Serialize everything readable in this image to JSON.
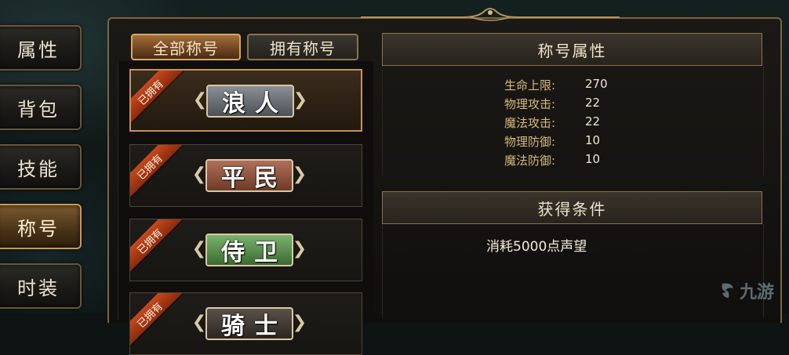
{
  "nav": {
    "items": [
      {
        "label": "属性",
        "active": false
      },
      {
        "label": "背包",
        "active": false
      },
      {
        "label": "技能",
        "active": false
      },
      {
        "label": "称号",
        "active": true
      },
      {
        "label": "时装",
        "active": false
      }
    ]
  },
  "filters": {
    "all_label": "全部称号",
    "owned_label": "拥有称号",
    "selected": "全部称号"
  },
  "titles": [
    {
      "name": "浪人",
      "owned_badge": "已拥有",
      "plaque_color": "#6a6e75",
      "selected": true
    },
    {
      "name": "平民",
      "owned_badge": "已拥有",
      "plaque_color": "#8e5440",
      "selected": false
    },
    {
      "name": "侍卫",
      "owned_badge": "已拥有",
      "plaque_color": "#5a8f4e",
      "selected": false
    },
    {
      "name": "骑士",
      "owned_badge": "已拥有",
      "plaque_color": "#4a4038",
      "selected": false
    }
  ],
  "attributes": {
    "header": "称号属性",
    "rows": [
      {
        "label": "生命上限:",
        "value": "270"
      },
      {
        "label": "物理攻击:",
        "value": "22"
      },
      {
        "label": "魔法攻击:",
        "value": "22"
      },
      {
        "label": "物理防御:",
        "value": "10"
      },
      {
        "label": "魔法防御:",
        "value": "10"
      }
    ]
  },
  "conditions": {
    "header": "获得条件",
    "text": "消耗5000点声望"
  },
  "watermark": {
    "text": "九游"
  },
  "colors": {
    "accent_gold": "#c99a52",
    "attr_label": "#d7b97b",
    "owned_ribbon": "#c64a1e"
  }
}
